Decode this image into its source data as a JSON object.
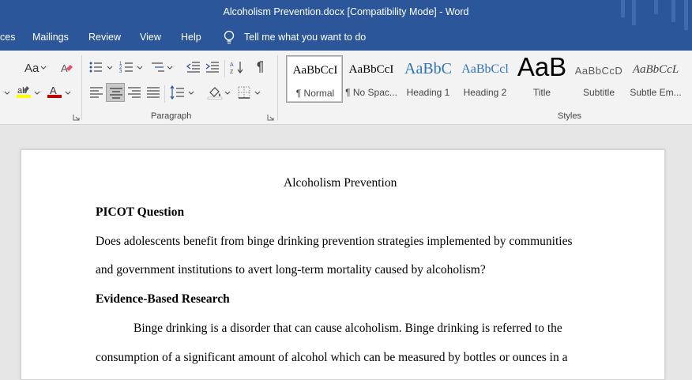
{
  "window": {
    "title": "Alcoholism Prevention.docx [Compatibility Mode]  -  Word",
    "accent_color": "#2b579a"
  },
  "tabs": [
    "ces",
    "Mailings",
    "Review",
    "View",
    "Help"
  ],
  "tell_me": {
    "label": "Tell me what you want to do",
    "icon": "lightbulb-icon"
  },
  "ribbon": {
    "font_group": {
      "change_case_label": "Aa",
      "icons": [
        "change-case-icon",
        "clear-formatting-icon",
        "highlight-icon",
        "font-color-icon"
      ],
      "highlight_color": "#ffff00",
      "font_color": "#c00000"
    },
    "paragraph_group": {
      "label": "Paragraph",
      "icons": [
        "bullets-icon",
        "numbering-icon",
        "multilevel-list-icon",
        "decrease-indent-icon",
        "increase-indent-icon",
        "sort-icon",
        "show-marks-icon",
        "align-left-icon",
        "align-center-icon",
        "align-right-icon",
        "justify-icon",
        "line-spacing-icon",
        "shading-icon",
        "borders-icon"
      ],
      "active_alignment": "center"
    },
    "styles_group": {
      "label": "Styles",
      "items": [
        {
          "preview": "AaBbCcI",
          "name": "¶ Normal",
          "selected": true,
          "color": "#000000"
        },
        {
          "preview": "AaBbCcI",
          "name": "¶ No Spac...",
          "selected": false,
          "color": "#000000"
        },
        {
          "preview": "AaBbC",
          "name": "Heading 1",
          "selected": false,
          "color": "#2e74b5"
        },
        {
          "preview": "AaBbCcl",
          "name": "Heading 2",
          "selected": false,
          "color": "#2e74b5"
        },
        {
          "preview": "AaB",
          "name": "Title",
          "selected": false,
          "color": "#000000"
        },
        {
          "preview": "AaBbCcD",
          "name": "Subtitle",
          "selected": false,
          "color": "#595959"
        },
        {
          "preview": "AaBbCcL",
          "name": "Subtle Em...",
          "selected": false,
          "color": "#404040"
        }
      ]
    }
  },
  "document": {
    "title": "Alcoholism Prevention",
    "heading1": "PICOT Question",
    "para1_line1": "Does adolescents benefit from binge drinking prevention strategies implemented by communities",
    "para1_line2": "and government institutions to avert long-term mortality caused by alcoholism?",
    "heading2": "Evidence-Based Research",
    "para2_line1": "Binge drinking is a disorder that can cause alcoholism. Binge drinking is referred to the",
    "para2_line2": "consumption of a significant amount of alcohol which can be measured by bottles or ounces in a"
  }
}
